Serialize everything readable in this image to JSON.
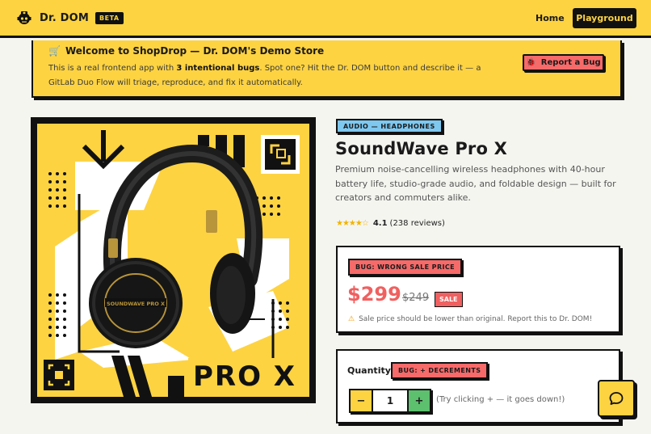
{
  "header": {
    "brand": "Dr. DOM",
    "badge": "BETA",
    "nav_home": "Home",
    "nav_playground": "Playground"
  },
  "banner": {
    "icon": "cart-icon",
    "title": "Welcome to ShopDrop — Dr. DOM's Demo Store",
    "text_before": "This is a real frontend app with ",
    "text_bold": "3 intentional bugs",
    "text_after": ". Spot one? Hit the Dr. DOM button and describe it — a GitLab Duo Flow will triage, reproduce, and fix it automatically.",
    "report_label": "Report a Bug"
  },
  "product": {
    "category": "AUDIO — HEADPHONES",
    "title": "SoundWave Pro X",
    "description": "Premium noise-cancelling wireless headphones with 40-hour battery life, studio-grade audio, and foldable design — built for creators and commuters alike.",
    "stars": "★★★★☆",
    "rating": "4.1",
    "review_count": "(238 reviews)",
    "image_label": "PRO X",
    "headphone_brand": "SOUNDWAVE PRO X"
  },
  "price_card": {
    "bug_label": "BUG: WRONG SALE PRICE",
    "current_price": "$299",
    "original_price": "$249",
    "sale_badge": "SALE",
    "note": "Sale price should be lower than original. Report this to Dr. DOM!"
  },
  "quantity_card": {
    "label": "Quantity",
    "bug_label": "BUG: + DECREMENTS",
    "minus": "−",
    "value": "1",
    "plus": "+",
    "hint": "(Try clicking + — it goes down!)"
  },
  "colors": {
    "brand_yellow": "#fdd342",
    "bug_red": "#f76a6a",
    "category_blue": "#7ec8f0",
    "plus_green": "#5cc06e"
  }
}
